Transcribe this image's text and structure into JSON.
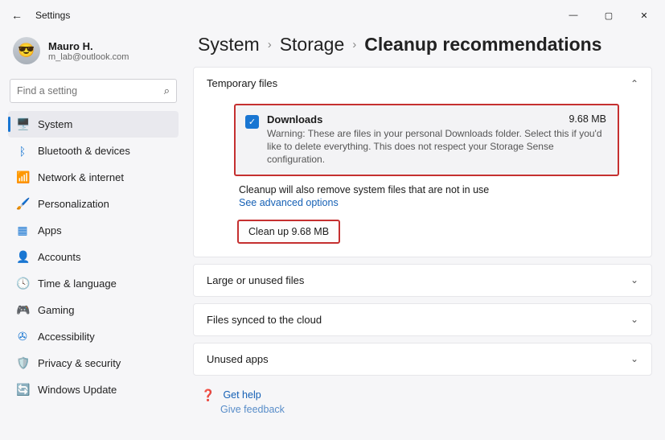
{
  "window": {
    "title": "Settings"
  },
  "profile": {
    "name": "Mauro H.",
    "email": "m_lab@outlook.com"
  },
  "search": {
    "placeholder": "Find a setting"
  },
  "nav": {
    "items": [
      {
        "label": "System"
      },
      {
        "label": "Bluetooth & devices"
      },
      {
        "label": "Network & internet"
      },
      {
        "label": "Personalization"
      },
      {
        "label": "Apps"
      },
      {
        "label": "Accounts"
      },
      {
        "label": "Time & language"
      },
      {
        "label": "Gaming"
      },
      {
        "label": "Accessibility"
      },
      {
        "label": "Privacy & security"
      },
      {
        "label": "Windows Update"
      }
    ]
  },
  "breadcrumb": {
    "a": "System",
    "b": "Storage",
    "c": "Cleanup recommendations"
  },
  "sections": {
    "temporary": {
      "title": "Temporary files",
      "file": {
        "title": "Downloads",
        "size": "9.68 MB",
        "desc": "Warning: These are files in your personal Downloads folder. Select this if you'd like to delete everything. This does not respect your Storage Sense configuration."
      },
      "note": "Cleanup will also remove system files that are not in use",
      "advanced": "See advanced options",
      "cleanup_button": "Clean up 9.68 MB"
    },
    "large": {
      "title": "Large or unused files"
    },
    "synced": {
      "title": "Files synced to the cloud"
    },
    "unused": {
      "title": "Unused apps"
    }
  },
  "footer": {
    "help": "Get help",
    "feedback": "Give feedback"
  }
}
